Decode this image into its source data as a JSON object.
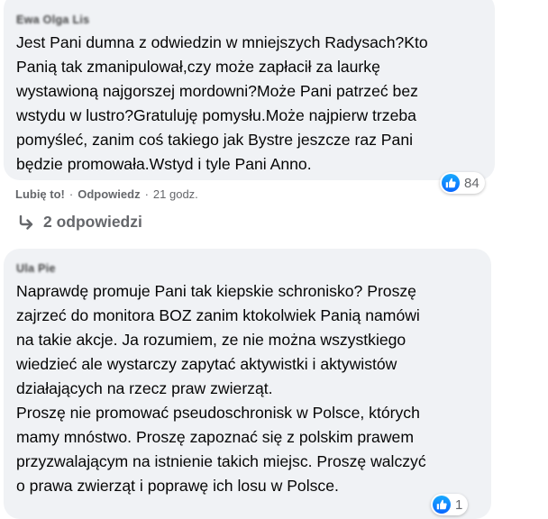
{
  "comments": [
    {
      "author": "Ewa Olga Lis",
      "text": "Jest Pani dumna z odwiedzin w mniejszych Radysach?Kto\nPanią tak zmanipulował,czy może zapłacił za laurkę\nwystawioną najgorszej mordowni?Może Pani patrzeć bez\nwstydu w lustro?Gratuluję pomysłu.Może najpierw trzeba\npomyśleć, zanim coś takiego jak Bystre jeszcze raz Pani\nbędzie promowała.Wstyd i tyle Pani Anno.",
      "reaction_count": "84",
      "like_label": "Lubię to!",
      "reply_label": "Odpowiedz",
      "separator": "·",
      "time": "21 godz.",
      "replies_label": "2 odpowiedzi"
    },
    {
      "author": "Ula Pie",
      "text": "Naprawdę promuje Pani tak kiepskie schronisko? Proszę\nzajrzeć do monitora BOZ zanim ktokolwiek Panią namówi\nna takie akcje. Ja rozumiem, ze nie można wszystkiego\nwiedzieć ale wystarczy zapytać aktywistki i aktywistów\ndziałających na rzecz praw zwierząt.\nProszę nie promować pseudoschronisk w Polsce, których\nmamy mnóstwo. Proszę zapoznać się z polskim prawem\nprzyzwalającym na istnienie takich miejsc. Proszę walczyć\no prawa zwierząt i poprawę ich losu w Polsce.",
      "reaction_count": "1"
    }
  ],
  "icons": {
    "reaction": "like-icon",
    "reply_arrow": "reply-arrow-icon"
  },
  "colors": {
    "bubble": "#f0f2f5",
    "text": "#050505",
    "secondary_text": "#65676b",
    "like_blue": "#0866ff"
  }
}
